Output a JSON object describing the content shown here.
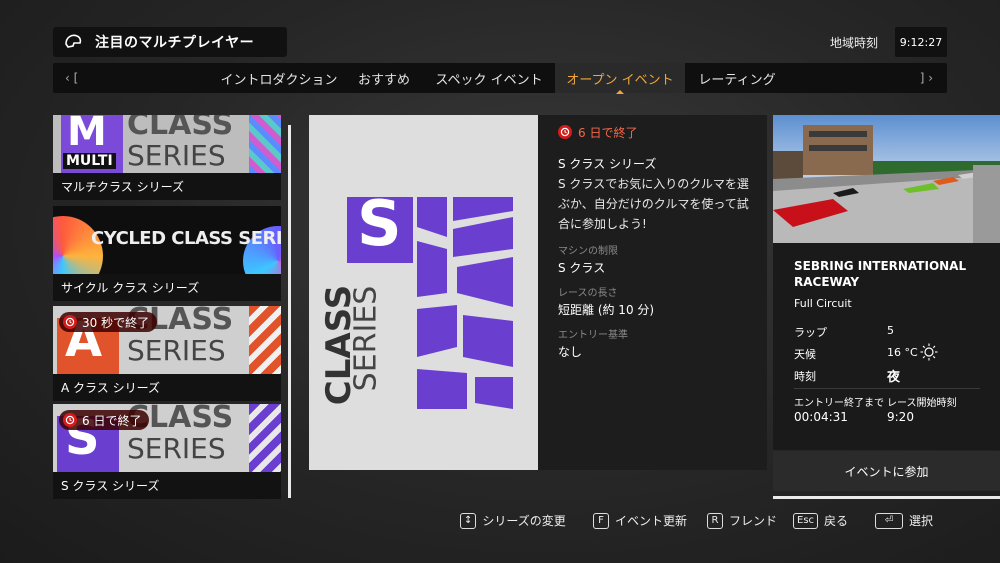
{
  "header": {
    "title": "注目のマルチプレイヤー",
    "clock_label": "地域時刻",
    "clock_value": "9:12:27"
  },
  "tabs": [
    {
      "label": "イントロダクション"
    },
    {
      "label": "おすすめ"
    },
    {
      "label": "スペック イベント"
    },
    {
      "label": "オープン イベント"
    },
    {
      "label": "レーティング"
    }
  ],
  "tab_nav": {
    "left": "‹ [",
    "right": "] ›"
  },
  "series": [
    {
      "label": "マルチクラス シリーズ",
      "art_title": "CLASS",
      "art_sub": "SERIES",
      "art_badge": "MULTI",
      "art_letter": "M"
    },
    {
      "label": "サイクル クラス シリーズ",
      "art_title": "CYCLED CLASS SERIES"
    },
    {
      "label": "A クラス シリーズ",
      "timer": "30 秒で終了",
      "art_title": "CLASS",
      "art_sub": "SERIES",
      "art_letter": "A"
    },
    {
      "label": "S クラス シリーズ",
      "timer": "6 日で終了",
      "art_title": "CLASS",
      "art_sub": "SERIES",
      "art_letter": "S"
    }
  ],
  "detail": {
    "timer": "6 日で終了",
    "name": "S クラス シリーズ",
    "description": "S クラスでお気に入りのクルマを選ぶか、自分だけのクルマを使って試合に参加しよう!",
    "car_label": "マシンの制限",
    "car_value": "S クラス",
    "length_label": "レースの長さ",
    "length_value": "短距離 (約 10 分)",
    "entry_label": "エントリー基準",
    "entry_value": "なし",
    "art_letter": "S",
    "art_class": "CLASS",
    "art_series": "SERIES"
  },
  "track": {
    "name": "SEBRING INTERNATIONAL RACEWAY",
    "layout": "Full Circuit",
    "laps_label": "ラップ",
    "laps_value": "5",
    "weather_label": "天候",
    "weather_value": "16 °C",
    "time_label": "時刻",
    "time_value": "夜",
    "entry_end_label": "エントリー終了まで",
    "entry_end_value": "00:04:31",
    "race_start_label": "レース開始時刻",
    "race_start_value": "9:20",
    "join_label": "イベントに参加"
  },
  "footer": [
    {
      "key": "↕",
      "label": "シリーズの変更"
    },
    {
      "key": "F",
      "label": "イベント更新"
    },
    {
      "key": "R",
      "label": "フレンド"
    },
    {
      "key": "Esc",
      "label": "戻る"
    },
    {
      "key": "⏎",
      "label": "選択"
    }
  ],
  "colors": {
    "accent": "#f0a63c",
    "purple": "#6a3fd0",
    "timer_red": "#d41b1b"
  }
}
